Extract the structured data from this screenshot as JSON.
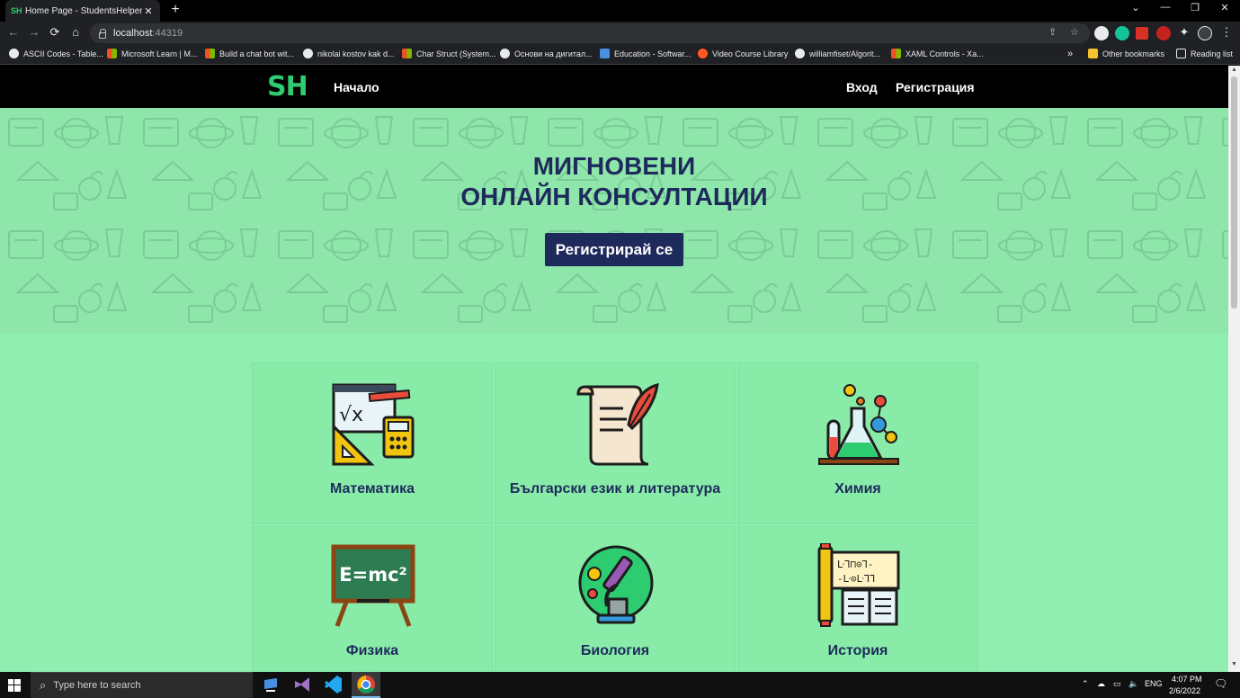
{
  "browser": {
    "tab_favicon": "SH",
    "tab_title": "Home Page - StudentsHelper",
    "tab_close": "✕",
    "new_tab": "+",
    "url_host": "localhost",
    "url_port": ":44319",
    "bookmarks": [
      {
        "label": "ASCII Codes - Table...",
        "icon": "globe-icon",
        "color": "#e8eaed"
      },
      {
        "label": "Microsoft Learn | M...",
        "icon": "microsoft-icon",
        "color": "#f25022"
      },
      {
        "label": "Build a chat bot wit...",
        "icon": "microsoft-icon",
        "color": "#f25022"
      },
      {
        "label": "nikolai kostov kak d...",
        "icon": "google-icon",
        "color": "#e8eaed"
      },
      {
        "label": "Char Struct (System...",
        "icon": "microsoft-icon",
        "color": "#f25022"
      },
      {
        "label": "Основи на дигитал...",
        "icon": "google-icon",
        "color": "#e8eaed"
      },
      {
        "label": "Education - Softwar...",
        "icon": "education-icon",
        "color": "#4a90e2"
      },
      {
        "label": "Video Course Library",
        "icon": "video-icon",
        "color": "#ff5722"
      },
      {
        "label": "williamfiset/Algorit...",
        "icon": "github-icon",
        "color": "#e8eaed"
      },
      {
        "label": "XAML Controls - Xa...",
        "icon": "microsoft-icon",
        "color": "#f25022"
      }
    ],
    "more_bookmarks": "»",
    "other_bookmarks": "Other bookmarks",
    "reading_list": "Reading list"
  },
  "site": {
    "brand": "SH",
    "nav_home": "Начало",
    "nav_login": "Вход",
    "nav_register": "Регистрация",
    "hero_line1": "МИГНОВЕНИ",
    "hero_line2": "ОНЛАЙН КОНСУЛТАЦИИ",
    "hero_button": "Регистрирай се",
    "subjects": [
      {
        "label": "Математика",
        "icon": "math-icon"
      },
      {
        "label": "Български език и литература",
        "icon": "scroll-quill-icon"
      },
      {
        "label": "Химия",
        "icon": "chemistry-icon"
      },
      {
        "label": "Физика",
        "icon": "physics-blackboard-icon"
      },
      {
        "label": "Биология",
        "icon": "microscope-icon"
      },
      {
        "label": "История",
        "icon": "history-scroll-icon"
      }
    ],
    "physics_formula": "E=mc²",
    "history_runes": [
      "ᒷ⅂⊓⊙⅂-",
      "-ᒷ⊙ᒷ⅂⅂"
    ]
  },
  "taskbar": {
    "search_placeholder": "Type here to search",
    "lang": "ENG",
    "time": "4:07 PM",
    "date": "2/6/2022"
  },
  "colors": {
    "accent_green": "#2ecc71",
    "navy": "#1f2a5c",
    "page_green": "#90eeb0"
  }
}
